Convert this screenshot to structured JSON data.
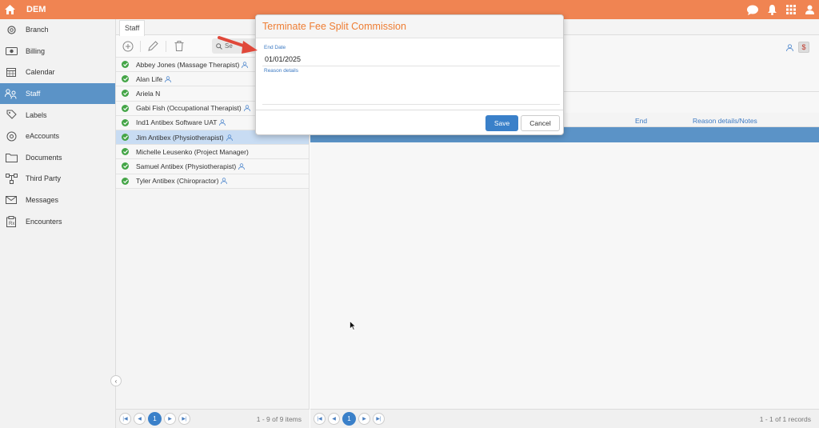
{
  "topbar": {
    "app_title": "DEM",
    "bg_color": "#f08452",
    "icons": [
      "home-icon",
      "chat-icon",
      "bell-icon",
      "grid-icon",
      "user-icon"
    ]
  },
  "sidebar": {
    "items": [
      {
        "label": "Branch",
        "icon": "gear-icon"
      },
      {
        "label": "Billing",
        "icon": "money-icon"
      },
      {
        "label": "Calendar",
        "icon": "calendar-icon"
      },
      {
        "label": "Staff",
        "icon": "staff-icon",
        "active": true
      },
      {
        "label": "Labels",
        "icon": "tag-icon"
      },
      {
        "label": "eAccounts",
        "icon": "at-icon"
      },
      {
        "label": "Documents",
        "icon": "folder-icon"
      },
      {
        "label": "Third Party",
        "icon": "network-icon"
      },
      {
        "label": "Messages",
        "icon": "envelope-icon"
      },
      {
        "label": "Encounters",
        "icon": "prescription-icon"
      }
    ],
    "active_color": "#5b93c7"
  },
  "staff_panel": {
    "tab_label": "Staff",
    "search_text": "Se",
    "staff": [
      {
        "name": "Abbey Jones (Massage Therapist)",
        "user_icon": true
      },
      {
        "name": "Alan Life",
        "user_icon": true
      },
      {
        "name": "Ariela N",
        "user_icon": false
      },
      {
        "name": "Gabi Fish (Occupational Therapist)",
        "user_icon": true
      },
      {
        "name": "Ind1 Antibex Software UAT",
        "user_icon": true
      },
      {
        "name": "Jim Antibex (Physiotherapist)",
        "user_icon": true,
        "selected": true
      },
      {
        "name": "Michelle Leusenko (Project Manager)",
        "user_icon": false
      },
      {
        "name": "Samuel Antibex (Physiotherapist)",
        "user_icon": true
      },
      {
        "name": "Tyler Antibex (Chiropractor)",
        "user_icon": true
      }
    ],
    "pager": {
      "page": "1",
      "info": "1 - 9 of 9 items"
    }
  },
  "main": {
    "dollar_label": "$",
    "columns": {
      "end": "End",
      "reason": "Reason details/Notes"
    },
    "pager": {
      "page": "1",
      "info": "1 - 1 of 1 records"
    }
  },
  "modal": {
    "title": "Terminate Fee Split Commission",
    "title_color": "#ee7d33",
    "end_date_label": "End Date",
    "end_date_value": "01/01/2025",
    "reason_label": "Reason details",
    "save_label": "Save",
    "cancel_label": "Cancel"
  }
}
